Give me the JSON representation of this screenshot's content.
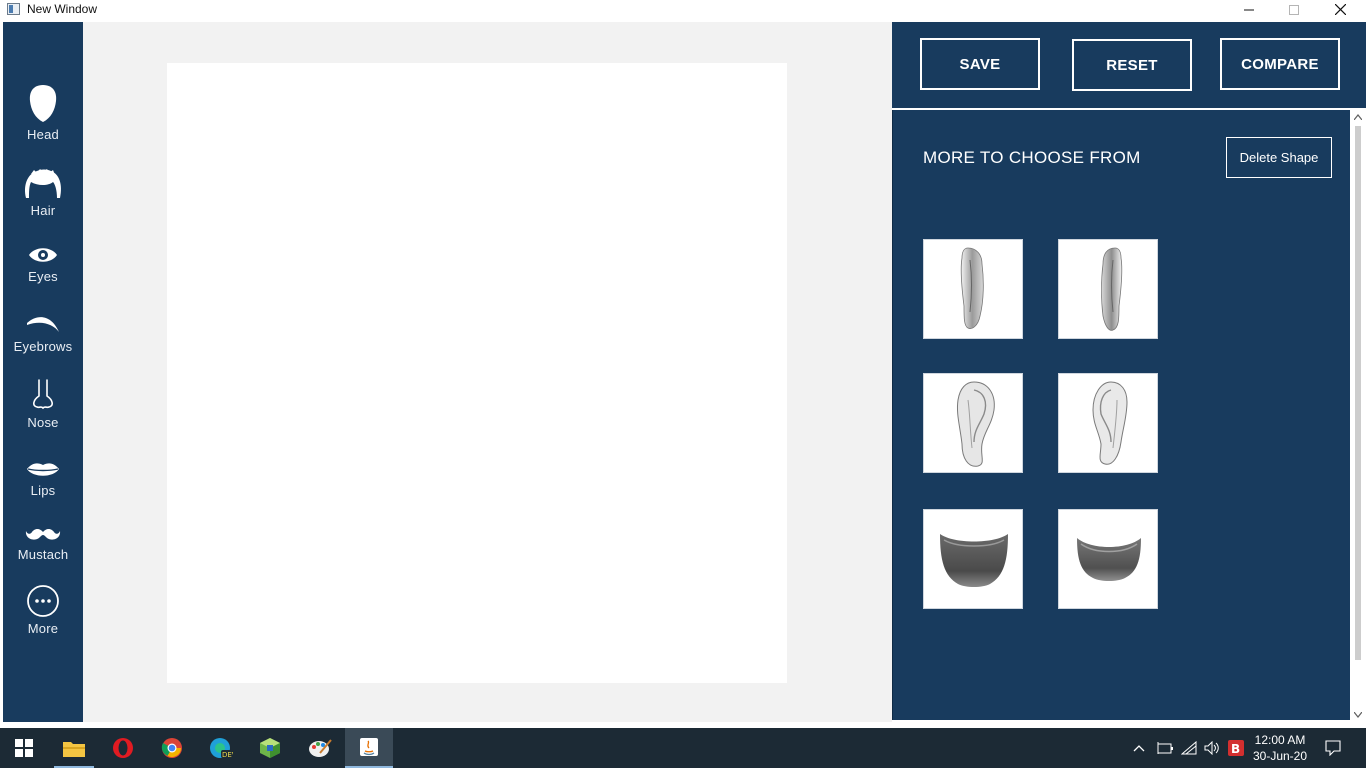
{
  "window": {
    "title": "New Window"
  },
  "sidebar": {
    "items": [
      {
        "label": "Head",
        "icon": "head-icon"
      },
      {
        "label": "Hair",
        "icon": "hair-icon"
      },
      {
        "label": "Eyes",
        "icon": "eye-icon"
      },
      {
        "label": "Eyebrows",
        "icon": "eyebrow-icon"
      },
      {
        "label": "Nose",
        "icon": "nose-icon"
      },
      {
        "label": "Lips",
        "icon": "lips-icon"
      },
      {
        "label": "Mustach",
        "icon": "mustache-icon"
      },
      {
        "label": "More",
        "icon": "more-icon"
      }
    ]
  },
  "toolbar": {
    "save_label": "SAVE",
    "reset_label": "RESET",
    "compare_label": "COMPARE"
  },
  "panel": {
    "title": "MORE TO CHOOSE FROM",
    "delete_label": "Delete Shape",
    "shapes": [
      {
        "name": "ear-side-left"
      },
      {
        "name": "ear-side-right"
      },
      {
        "name": "ear-front-left"
      },
      {
        "name": "ear-front-right"
      },
      {
        "name": "jaw-wide"
      },
      {
        "name": "jaw-narrow"
      }
    ]
  },
  "taskbar": {
    "apps": [
      "start-icon",
      "file-explorer-icon",
      "opera-icon",
      "chrome-icon",
      "edge-dev-icon",
      "package-icon",
      "paint-icon",
      "java-icon"
    ],
    "time": "12:00 AM",
    "date": "30-Jun-20"
  },
  "colors": {
    "panel": "#183b5e",
    "workspace": "#f2f2f2",
    "taskbar": "#1c2a35"
  }
}
